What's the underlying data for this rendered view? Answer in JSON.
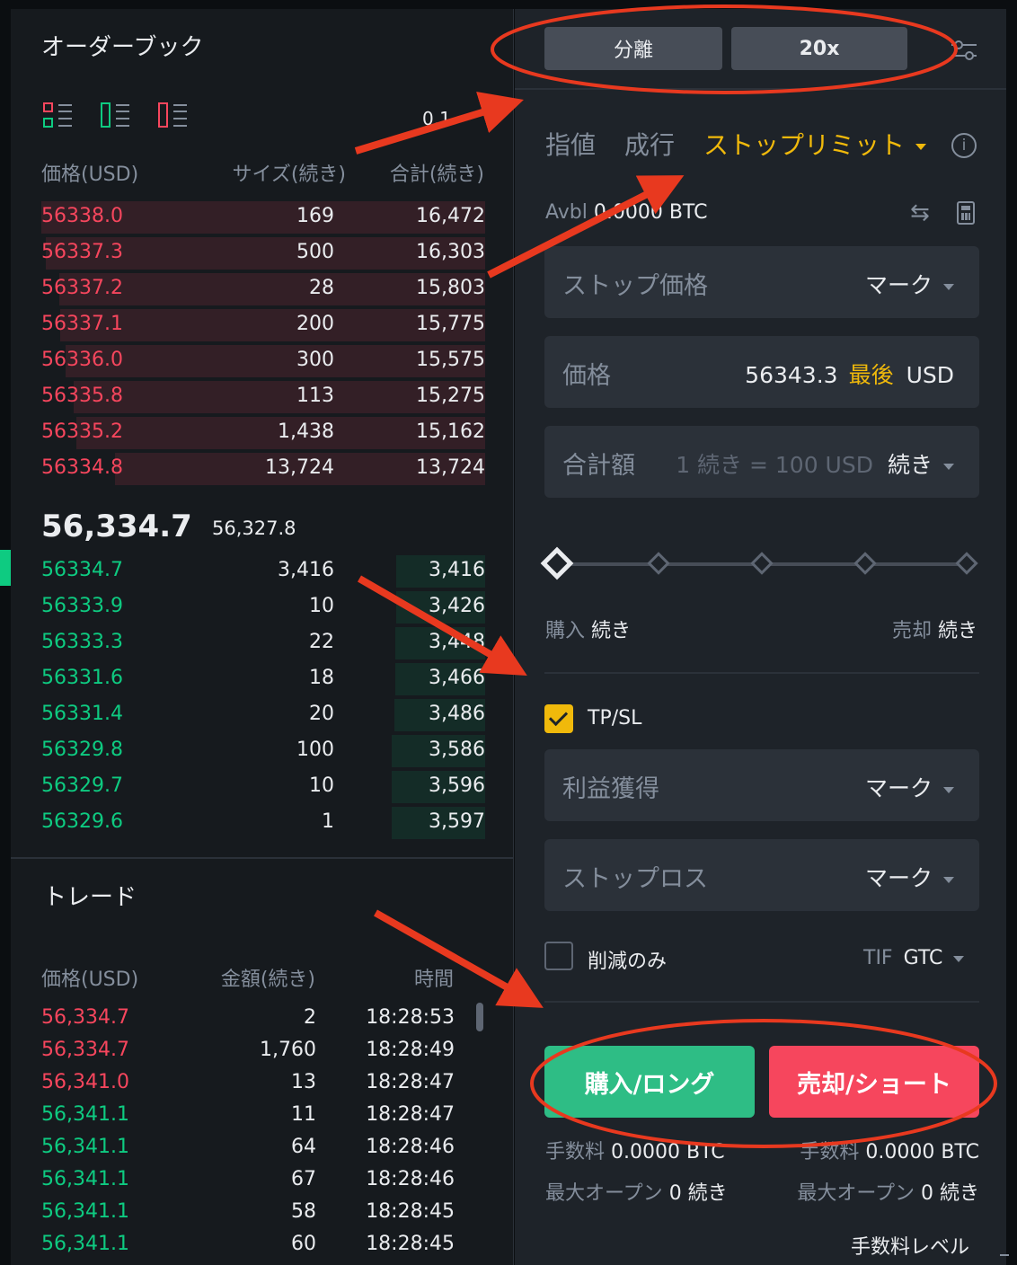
{
  "orderbook": {
    "title": "オーダーブック",
    "precision": "0.1",
    "headers": {
      "price": "価格(USD)",
      "size": "サイズ(続き)",
      "total": "合計(続き)"
    },
    "asks": [
      {
        "price": "56338.0",
        "size": "169",
        "total": "16,472"
      },
      {
        "price": "56337.3",
        "size": "500",
        "total": "16,303"
      },
      {
        "price": "56337.2",
        "size": "28",
        "total": "15,803"
      },
      {
        "price": "56337.1",
        "size": "200",
        "total": "15,775"
      },
      {
        "price": "56336.0",
        "size": "300",
        "total": "15,575"
      },
      {
        "price": "56335.8",
        "size": "113",
        "total": "15,275"
      },
      {
        "price": "56335.2",
        "size": "1,438",
        "total": "15,162"
      },
      {
        "price": "56334.8",
        "size": "13,724",
        "total": "13,724"
      }
    ],
    "last_price": "56,334.7",
    "mark_price": "56,327.8",
    "bids": [
      {
        "price": "56334.7",
        "size": "3,416",
        "total": "3,416"
      },
      {
        "price": "56333.9",
        "size": "10",
        "total": "3,426"
      },
      {
        "price": "56333.3",
        "size": "22",
        "total": "3,448"
      },
      {
        "price": "56331.6",
        "size": "18",
        "total": "3,466"
      },
      {
        "price": "56331.4",
        "size": "20",
        "total": "3,486"
      },
      {
        "price": "56329.8",
        "size": "100",
        "total": "3,586"
      },
      {
        "price": "56329.7",
        "size": "10",
        "total": "3,596"
      },
      {
        "price": "56329.6",
        "size": "1",
        "total": "3,597"
      }
    ]
  },
  "trades": {
    "title": "トレード",
    "headers": {
      "price": "価格(USD)",
      "amount": "金額(続き)",
      "time": "時間"
    },
    "rows": [
      {
        "price": "56,334.7",
        "amount": "2",
        "time": "18:28:53",
        "side": "sell"
      },
      {
        "price": "56,334.7",
        "amount": "1,760",
        "time": "18:28:49",
        "side": "sell"
      },
      {
        "price": "56,341.0",
        "amount": "13",
        "time": "18:28:47",
        "side": "sell"
      },
      {
        "price": "56,341.1",
        "amount": "11",
        "time": "18:28:47",
        "side": "buy"
      },
      {
        "price": "56,341.1",
        "amount": "64",
        "time": "18:28:46",
        "side": "buy"
      },
      {
        "price": "56,341.1",
        "amount": "67",
        "time": "18:28:46",
        "side": "buy"
      },
      {
        "price": "56,341.1",
        "amount": "58",
        "time": "18:28:45",
        "side": "buy"
      },
      {
        "price": "56,341.1",
        "amount": "60",
        "time": "18:28:45",
        "side": "buy"
      }
    ]
  },
  "order_form": {
    "margin_mode": "分離",
    "leverage": "20x",
    "tabs": [
      "指値",
      "成行",
      "ストップリミット"
    ],
    "active_tab": 2,
    "avbl_label": "Avbl",
    "avbl_value": "0.0000 BTC",
    "stop_price": {
      "label": "ストップ価格",
      "type": "マーク"
    },
    "price": {
      "label": "価格",
      "value": "56343.3",
      "tag": "最後",
      "unit": "USD"
    },
    "total": {
      "label": "合計額",
      "hint": "1 続き = 100 USD",
      "unit": "続き"
    },
    "slider_level": 0,
    "buy_label": "購入",
    "sell_label": "売却",
    "unit": "続き",
    "tpsl": {
      "label": "TP/SL",
      "checked": true
    },
    "take_profit": {
      "label": "利益獲得",
      "type": "マーク"
    },
    "stop_loss": {
      "label": "ストップロス",
      "type": "マーク"
    },
    "reduce_only": {
      "label": "削減のみ",
      "checked": false
    },
    "tif_label": "TIF",
    "tif_value": "GTC",
    "buy_button": "購入/ロング",
    "sell_button": "売却/ショート",
    "fee_label": "手数料",
    "fee_value": "0.0000 BTC",
    "max_open_label": "最大オープン",
    "max_open_value": "0 続き",
    "fee_level": "手数料レベル"
  },
  "colors": {
    "ask": "#f6465d",
    "bid": "#0ecb81",
    "accent": "#f0b90b",
    "annotation": "#e8391f"
  }
}
